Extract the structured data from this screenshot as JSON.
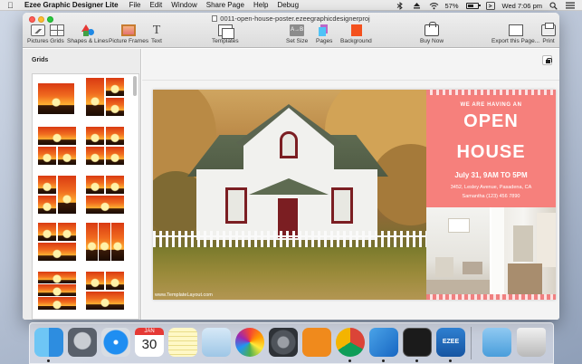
{
  "menubar": {
    "app_name": "Ezee Graphic Designer Lite",
    "menus": [
      "File",
      "Edit",
      "Window",
      "Share Page",
      "Help",
      "Debug"
    ],
    "battery": "57%",
    "clock": "Wed 7:06 pm"
  },
  "window": {
    "title": "0011-open-house-poster.ezeegraphicdesignerproj"
  },
  "toolbar": {
    "pictures": "Pictures",
    "grids": "Grids",
    "shapes_lines": "Shapes & Lines",
    "picture_frames": "Picture Frames",
    "text": "Text",
    "templates": "Templates",
    "set_size": "Set Size",
    "pages": "Pages",
    "background": "Background",
    "buy_now": "Buy Now",
    "export": "Export this Page...",
    "print": "Print",
    "set_size_glyph": "A→B"
  },
  "panel": {
    "title": "Grids"
  },
  "poster": {
    "watermark": "www.TemplateLayout.com",
    "we_are_having": "WE ARE HAVING AN",
    "open": "OPEN",
    "house": "HOUSE",
    "date": "July 31, 9AM TO 5PM",
    "address": "3452, Lesley Avenue, Pasadena, CA",
    "phone": "Samantha  (123) 456 7890"
  },
  "colors": {
    "accent": "#f6807c",
    "door_trim": "#7b1e22"
  },
  "dock": {
    "calendar_month": "JAN",
    "calendar_day": "30",
    "ezee_badge": "EZEE"
  }
}
